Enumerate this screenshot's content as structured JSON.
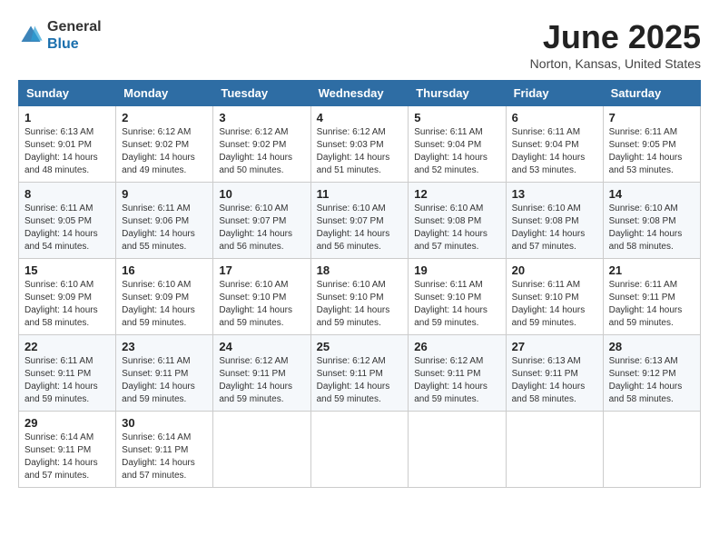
{
  "header": {
    "logo_line1": "General",
    "logo_line2": "Blue",
    "month_year": "June 2025",
    "location": "Norton, Kansas, United States"
  },
  "weekdays": [
    "Sunday",
    "Monday",
    "Tuesday",
    "Wednesday",
    "Thursday",
    "Friday",
    "Saturday"
  ],
  "weeks": [
    [
      {
        "day": "1",
        "sunrise": "6:13 AM",
        "sunset": "9:01 PM",
        "daylight": "14 hours and 48 minutes."
      },
      {
        "day": "2",
        "sunrise": "6:12 AM",
        "sunset": "9:02 PM",
        "daylight": "14 hours and 49 minutes."
      },
      {
        "day": "3",
        "sunrise": "6:12 AM",
        "sunset": "9:02 PM",
        "daylight": "14 hours and 50 minutes."
      },
      {
        "day": "4",
        "sunrise": "6:12 AM",
        "sunset": "9:03 PM",
        "daylight": "14 hours and 51 minutes."
      },
      {
        "day": "5",
        "sunrise": "6:11 AM",
        "sunset": "9:04 PM",
        "daylight": "14 hours and 52 minutes."
      },
      {
        "day": "6",
        "sunrise": "6:11 AM",
        "sunset": "9:04 PM",
        "daylight": "14 hours and 53 minutes."
      },
      {
        "day": "7",
        "sunrise": "6:11 AM",
        "sunset": "9:05 PM",
        "daylight": "14 hours and 53 minutes."
      }
    ],
    [
      {
        "day": "8",
        "sunrise": "6:11 AM",
        "sunset": "9:05 PM",
        "daylight": "14 hours and 54 minutes."
      },
      {
        "day": "9",
        "sunrise": "6:11 AM",
        "sunset": "9:06 PM",
        "daylight": "14 hours and 55 minutes."
      },
      {
        "day": "10",
        "sunrise": "6:10 AM",
        "sunset": "9:07 PM",
        "daylight": "14 hours and 56 minutes."
      },
      {
        "day": "11",
        "sunrise": "6:10 AM",
        "sunset": "9:07 PM",
        "daylight": "14 hours and 56 minutes."
      },
      {
        "day": "12",
        "sunrise": "6:10 AM",
        "sunset": "9:08 PM",
        "daylight": "14 hours and 57 minutes."
      },
      {
        "day": "13",
        "sunrise": "6:10 AM",
        "sunset": "9:08 PM",
        "daylight": "14 hours and 57 minutes."
      },
      {
        "day": "14",
        "sunrise": "6:10 AM",
        "sunset": "9:08 PM",
        "daylight": "14 hours and 58 minutes."
      }
    ],
    [
      {
        "day": "15",
        "sunrise": "6:10 AM",
        "sunset": "9:09 PM",
        "daylight": "14 hours and 58 minutes."
      },
      {
        "day": "16",
        "sunrise": "6:10 AM",
        "sunset": "9:09 PM",
        "daylight": "14 hours and 59 minutes."
      },
      {
        "day": "17",
        "sunrise": "6:10 AM",
        "sunset": "9:10 PM",
        "daylight": "14 hours and 59 minutes."
      },
      {
        "day": "18",
        "sunrise": "6:10 AM",
        "sunset": "9:10 PM",
        "daylight": "14 hours and 59 minutes."
      },
      {
        "day": "19",
        "sunrise": "6:11 AM",
        "sunset": "9:10 PM",
        "daylight": "14 hours and 59 minutes."
      },
      {
        "day": "20",
        "sunrise": "6:11 AM",
        "sunset": "9:10 PM",
        "daylight": "14 hours and 59 minutes."
      },
      {
        "day": "21",
        "sunrise": "6:11 AM",
        "sunset": "9:11 PM",
        "daylight": "14 hours and 59 minutes."
      }
    ],
    [
      {
        "day": "22",
        "sunrise": "6:11 AM",
        "sunset": "9:11 PM",
        "daylight": "14 hours and 59 minutes."
      },
      {
        "day": "23",
        "sunrise": "6:11 AM",
        "sunset": "9:11 PM",
        "daylight": "14 hours and 59 minutes."
      },
      {
        "day": "24",
        "sunrise": "6:12 AM",
        "sunset": "9:11 PM",
        "daylight": "14 hours and 59 minutes."
      },
      {
        "day": "25",
        "sunrise": "6:12 AM",
        "sunset": "9:11 PM",
        "daylight": "14 hours and 59 minutes."
      },
      {
        "day": "26",
        "sunrise": "6:12 AM",
        "sunset": "9:11 PM",
        "daylight": "14 hours and 59 minutes."
      },
      {
        "day": "27",
        "sunrise": "6:13 AM",
        "sunset": "9:11 PM",
        "daylight": "14 hours and 58 minutes."
      },
      {
        "day": "28",
        "sunrise": "6:13 AM",
        "sunset": "9:12 PM",
        "daylight": "14 hours and 58 minutes."
      }
    ],
    [
      {
        "day": "29",
        "sunrise": "6:14 AM",
        "sunset": "9:11 PM",
        "daylight": "14 hours and 57 minutes."
      },
      {
        "day": "30",
        "sunrise": "6:14 AM",
        "sunset": "9:11 PM",
        "daylight": "14 hours and 57 minutes."
      },
      null,
      null,
      null,
      null,
      null
    ]
  ]
}
